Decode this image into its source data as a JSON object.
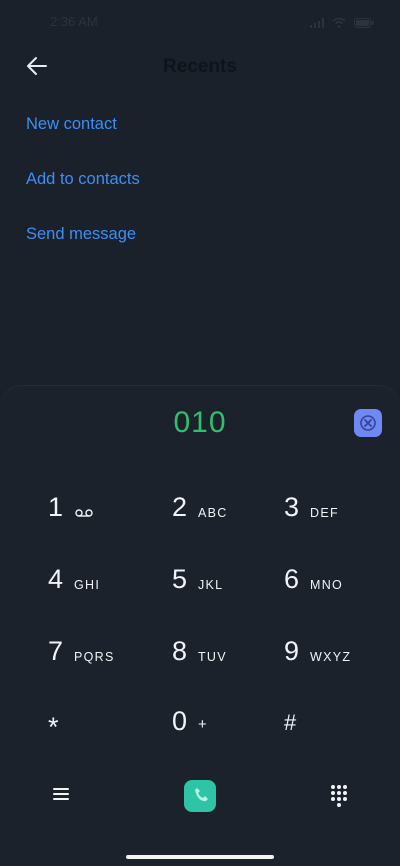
{
  "status_bar": {
    "time": "2:36 AM"
  },
  "header": {
    "title": "Recents"
  },
  "actions": {
    "new_contact": "New contact",
    "add_to_contacts": "Add to contacts",
    "send_message": "Send message"
  },
  "dialpad": {
    "number": "010",
    "keys": [
      {
        "digit": "1",
        "letters": ""
      },
      {
        "digit": "2",
        "letters": "ABC"
      },
      {
        "digit": "3",
        "letters": "DEF"
      },
      {
        "digit": "4",
        "letters": "GHI"
      },
      {
        "digit": "5",
        "letters": "JKL"
      },
      {
        "digit": "6",
        "letters": "MNO"
      },
      {
        "digit": "7",
        "letters": "PQRS"
      },
      {
        "digit": "8",
        "letters": "TUV"
      },
      {
        "digit": "9",
        "letters": "WXYZ"
      },
      {
        "digit": "*",
        "letters": ""
      },
      {
        "digit": "0",
        "letters": "+"
      },
      {
        "digit": "#",
        "letters": ""
      }
    ]
  },
  "icons": {
    "back": "arrow-left-icon",
    "clear": "close-circle-icon",
    "voicemail": "voicemail-icon",
    "menu": "menu-icon",
    "call": "phone-icon",
    "keypad": "dialpad-icon"
  },
  "colors": {
    "background": "#1a212b",
    "link": "#3d8ef5",
    "number": "#2fbf6e",
    "clear_button": "#6f88f2",
    "call_button": "#2ec4a6"
  }
}
